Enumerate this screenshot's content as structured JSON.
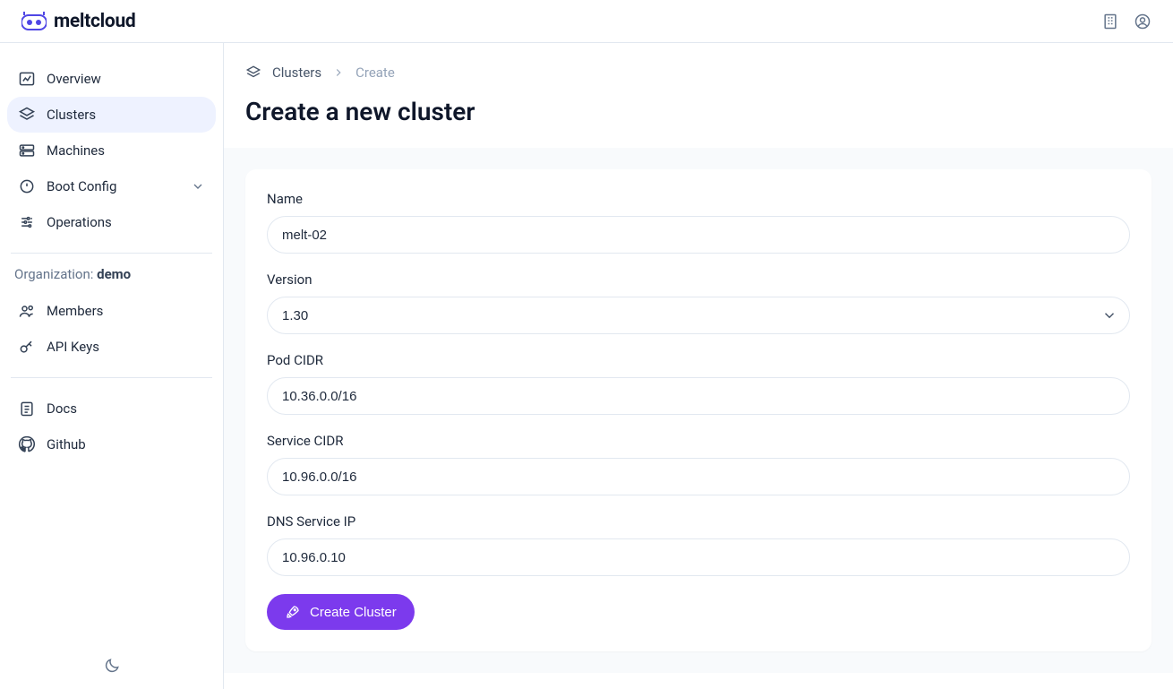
{
  "brand": {
    "name": "meltcloud"
  },
  "sidebar": {
    "items": [
      {
        "label": "Overview"
      },
      {
        "label": "Clusters"
      },
      {
        "label": "Machines"
      },
      {
        "label": "Boot Config"
      },
      {
        "label": "Operations"
      }
    ],
    "org_label_prefix": "Organization: ",
    "org_name": "demo",
    "org_items": [
      {
        "label": "Members"
      },
      {
        "label": "API Keys"
      }
    ],
    "links": [
      {
        "label": "Docs"
      },
      {
        "label": "Github"
      }
    ]
  },
  "breadcrumb": {
    "root": "Clusters",
    "current": "Create"
  },
  "page": {
    "title": "Create a new cluster"
  },
  "form": {
    "name": {
      "label": "Name",
      "value": "melt-02"
    },
    "version": {
      "label": "Version",
      "value": "1.30"
    },
    "pod_cidr": {
      "label": "Pod CIDR",
      "value": "10.36.0.0/16"
    },
    "service_cidr": {
      "label": "Service CIDR",
      "value": "10.96.0.0/16"
    },
    "dns_ip": {
      "label": "DNS Service IP",
      "value": "10.96.0.10"
    },
    "submit": "Create Cluster"
  }
}
